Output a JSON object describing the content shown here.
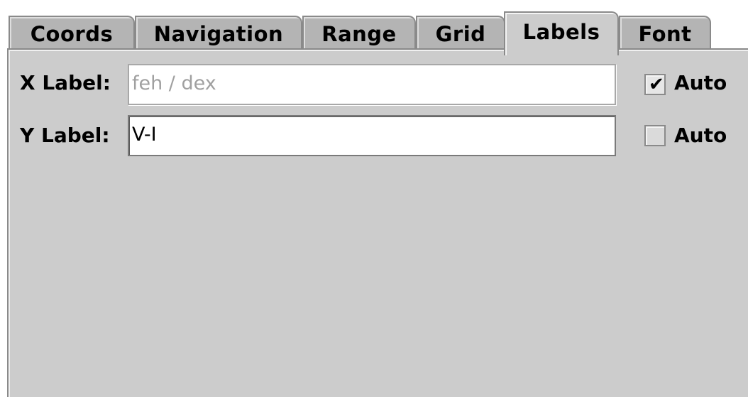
{
  "tabs": [
    {
      "label": "Coords",
      "selected": false
    },
    {
      "label": "Navigation",
      "selected": false
    },
    {
      "label": "Range",
      "selected": false
    },
    {
      "label": "Grid",
      "selected": false
    },
    {
      "label": "Labels",
      "selected": true
    },
    {
      "label": "Font",
      "selected": false
    }
  ],
  "x_axis": {
    "label": "X Label:",
    "value": "feh / dex",
    "field_enabled": false,
    "auto_label": "Auto",
    "auto_checked": true
  },
  "y_axis": {
    "label": "Y Label:",
    "value": "V-I",
    "field_enabled": true,
    "auto_label": "Auto",
    "auto_checked": false
  },
  "colors": {
    "panel_background": "#cccccc",
    "tab_background": "#b4b4b4",
    "disabled_text": "#a0a0a0"
  }
}
